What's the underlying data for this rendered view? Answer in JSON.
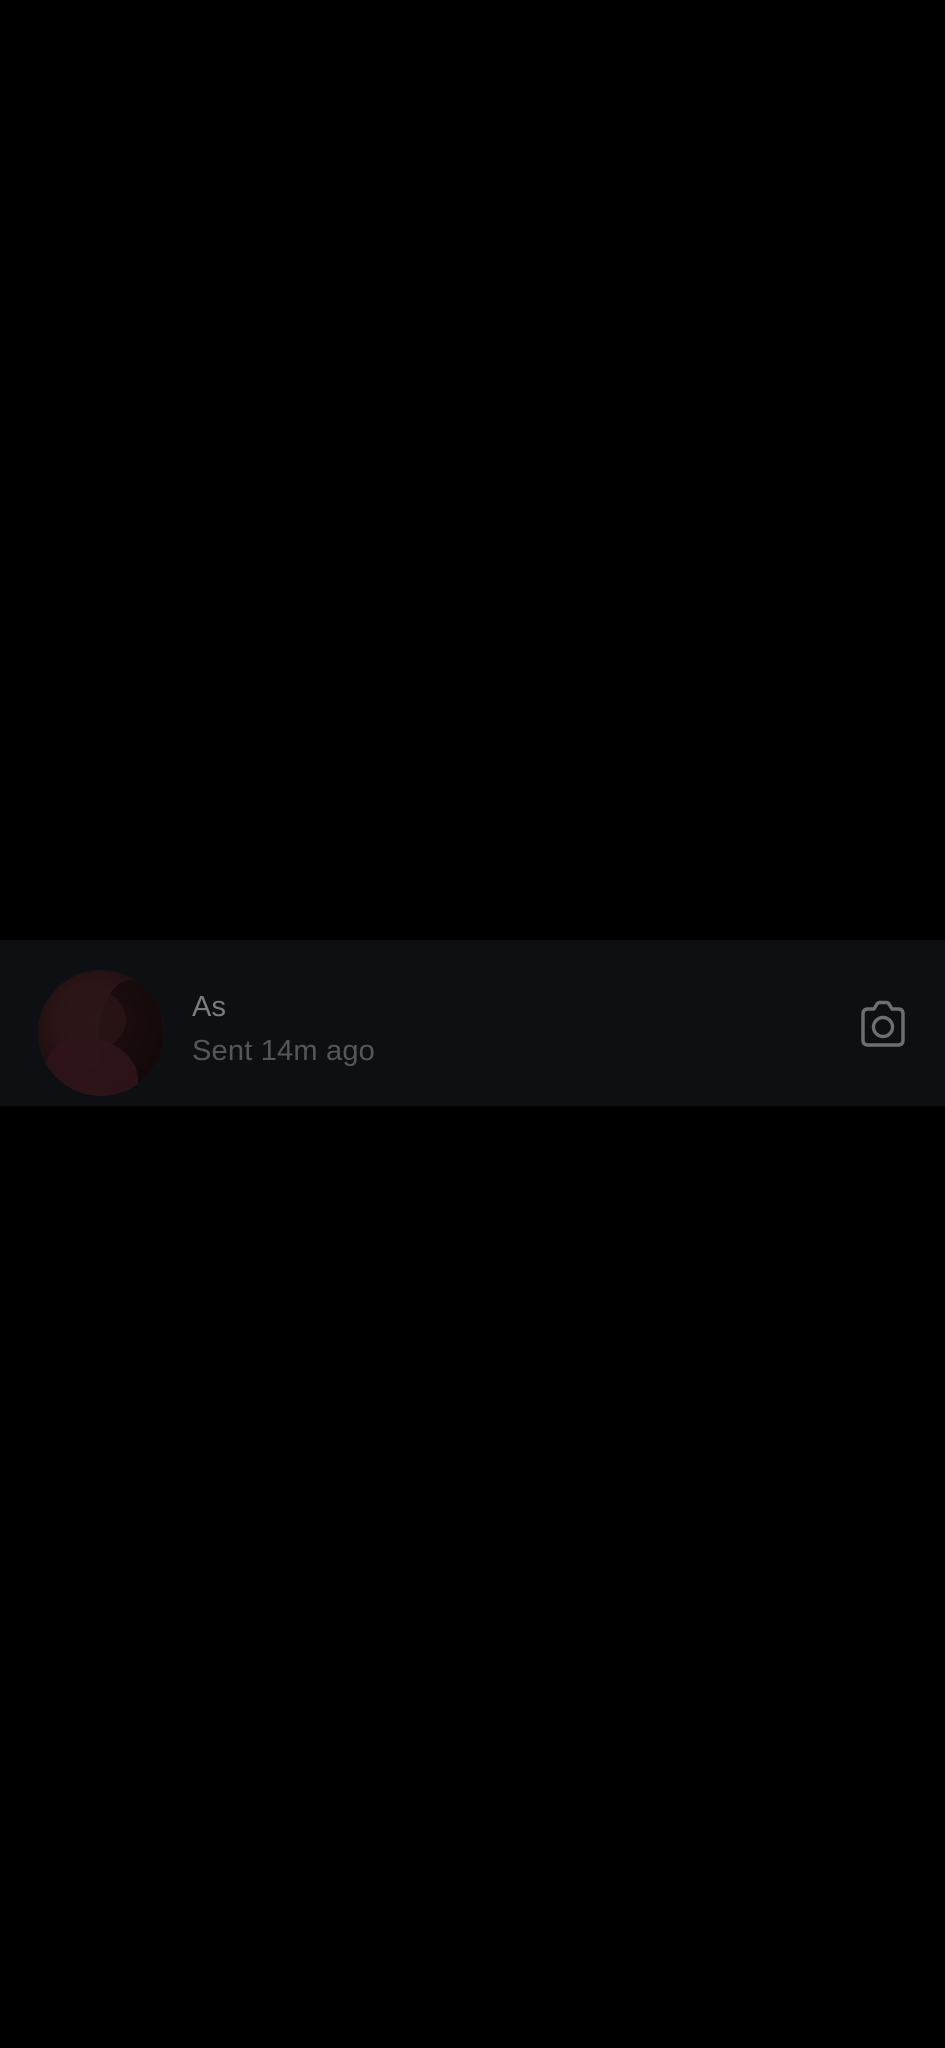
{
  "thread": {
    "name": "As",
    "status": "Sent 14m ago",
    "action_icon": "camera-icon"
  },
  "colors": {
    "background": "#000000",
    "row_background": "#0e0f13",
    "name_text": "#7c7c80",
    "status_text": "#55565c",
    "icon_stroke": "#6e6f74"
  }
}
